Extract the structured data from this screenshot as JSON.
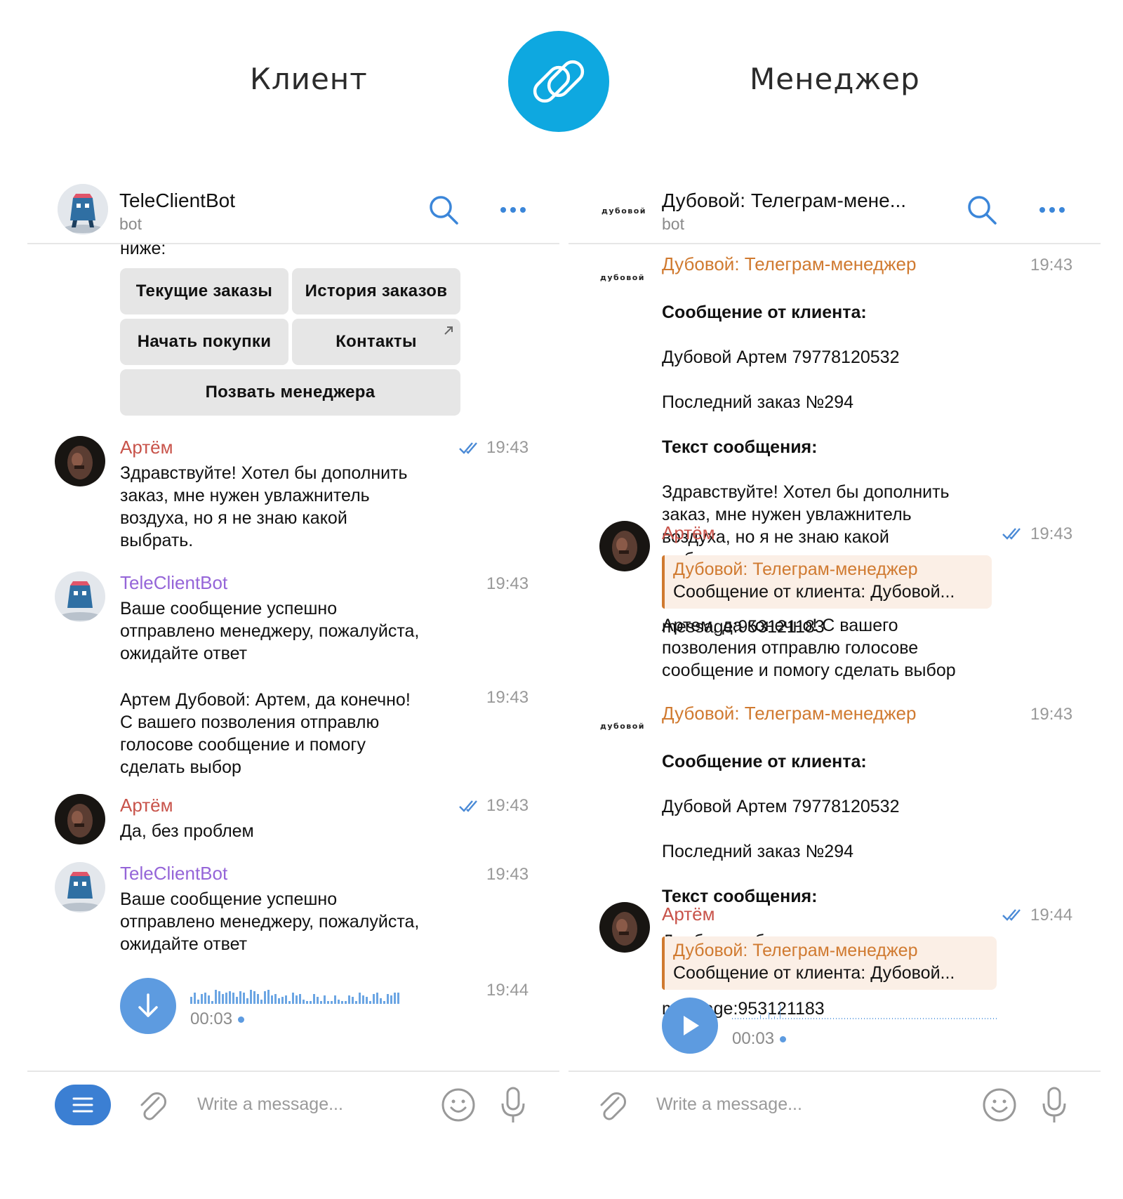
{
  "labels": {
    "client": "Клиент",
    "manager": "Менеджер"
  },
  "colors": {
    "accent": "#0ea8e0",
    "bot_name": "#9565d8",
    "user_name": "#c8534a",
    "channel_name": "#d07a30",
    "voice": "#5d9be0",
    "menu_button": "#3b7fd3"
  },
  "client": {
    "header": {
      "title": "TeleClientBot",
      "subtitle": "bot"
    },
    "cut_text": "ниже:",
    "keyboard": [
      "Текущие заказы",
      "История заказов",
      "Начать покупки",
      "Контакты",
      "Позвать менеджера"
    ],
    "messages": [
      {
        "sender": "Артём",
        "time": "19:43",
        "text": "Здравствуйте! Хотел бы дополнить\nзаказ, мне нужен увлажнитель\nвоздуха, но я не знаю какой\nвыбрать."
      },
      {
        "sender": "TeleClientBot",
        "time": "19:43",
        "text": "Ваше сообщение успешно\nотправлено менеджеру, пожалуйста,\nожидайте ответ"
      },
      {
        "time": "19:43",
        "text": "Артем Дубовой: Артем, да конечно!\nС вашего позволения отправлю\nголосове сообщение и помогу\nсделать выбор"
      },
      {
        "sender": "Артём",
        "time": "19:43",
        "text": "Да, без проблем"
      },
      {
        "sender": "TeleClientBot",
        "time": "19:43",
        "text": "Ваше сообщение успешно\nотправлено менеджеру, пожалуйста,\nожидайте ответ"
      },
      {
        "time": "19:44",
        "duration": "00:03"
      }
    ],
    "input_placeholder": "Write a message..."
  },
  "manager": {
    "header": {
      "title": "Дубовой: Телеграм-мене...",
      "subtitle": "bot",
      "logo": "дубовой"
    },
    "messages": [
      {
        "sender": "Дубовой: Телеграм-менеджер",
        "logo": "дубовой",
        "time": "19:43",
        "label1": "Сообщение от клиента:",
        "line1": "Дубовой Артем 79778120532",
        "line2": "Последний заказ №294",
        "label2": "Текст сообщения:",
        "text": "Здравствуйте! Хотел бы дополнить\nзаказ, мне нужен увлажнитель\nвоздуха, но я не знаю какой\nвыбрать.",
        "footer": "message:953121183"
      },
      {
        "sender": "Артём",
        "time": "19:43",
        "reply": {
          "title": "Дубовой: Телеграм-менеджер",
          "text": "Сообщение от клиента: Дубовой..."
        },
        "text": "Артем, да конечно! С вашего\nпозволения отправлю голосове\nсообщение и помогу сделать выбор"
      },
      {
        "sender": "Дубовой: Телеграм-менеджер",
        "logo": "дубовой",
        "time": "19:43",
        "label1": "Сообщение от клиента:",
        "line1": "Дубовой Артем 79778120532",
        "line2": "Последний заказ №294",
        "label2": "Текст сообщения:",
        "text": "Да, без проблем",
        "footer": "message:953121183"
      },
      {
        "sender": "Артём",
        "time": "19:44",
        "reply": {
          "title": "Дубовой: Телеграм-менеджер",
          "text": "Сообщение от клиента: Дубовой..."
        },
        "duration": "00:03"
      }
    ],
    "input_placeholder": "Write a message..."
  }
}
